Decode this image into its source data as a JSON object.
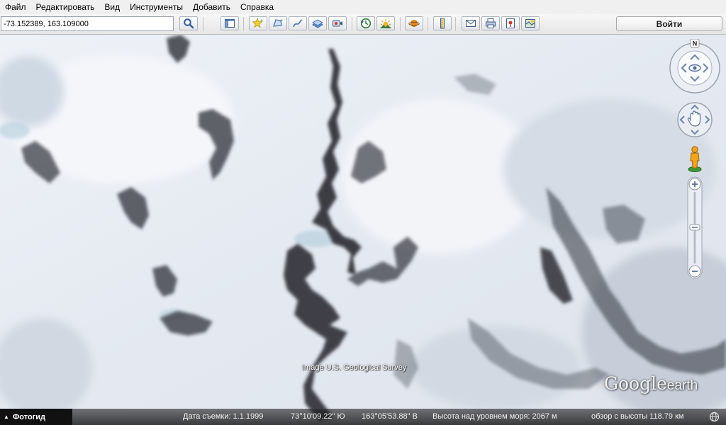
{
  "menu": {
    "items": [
      "Файл",
      "Редактировать",
      "Вид",
      "Инструменты",
      "Добавить",
      "Справка"
    ]
  },
  "search": {
    "value": "-73.152389, 163.109000"
  },
  "toolbar": {
    "signin_label": "Войти",
    "icons": [
      "search-icon",
      "sidebar-icon",
      "placemark-icon",
      "polygon-icon",
      "path-icon",
      "image-overlay-icon",
      "record-tour-icon",
      "historical-imagery-icon",
      "sunlight-icon",
      "planet-icon",
      "ruler-icon",
      "email-icon",
      "print-icon",
      "save-image-icon",
      "map-view-icon"
    ]
  },
  "map": {
    "attribution": "Image U.S. Geological Survey",
    "logo_google": "Google",
    "logo_earth": "earth",
    "compass_north": "N"
  },
  "status": {
    "tour_label": "Фотогид",
    "date": "Дата съемки: 1.1.1999",
    "lat": "73°10'09.22\" Ю",
    "lon": "163°05'53.88\" В",
    "elevation": "Высота над уровнем моря:  2067 м",
    "eye_alt": "обзор с высоты  118.79 км"
  },
  "colors": {
    "snow": "#e6ebf2",
    "rock": "#2d2f36",
    "ice_blue": "#bcd3e0",
    "signin_text": "#222222"
  }
}
